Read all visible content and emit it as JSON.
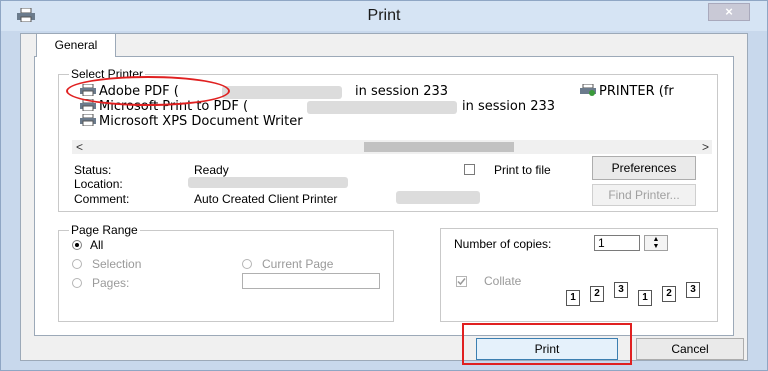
{
  "window": {
    "title": "Print",
    "close_symbol": "×"
  },
  "tabs": [
    {
      "label": "General"
    }
  ],
  "select_printer": {
    "title": "Select Printer",
    "printers": [
      {
        "name": "Adobe PDF (",
        "session": "in session 233"
      },
      {
        "name": "Microsoft Print to PDF (",
        "session": "in session 233"
      },
      {
        "name": "Microsoft XPS Document Writer",
        "session": ""
      },
      {
        "name": "PRINTER (fr",
        "session": ""
      }
    ],
    "scroll_left": "<",
    "scroll_right": ">",
    "status_label": "Status:",
    "status_value": "Ready",
    "location_label": "Location:",
    "location_value": "",
    "comment_label": "Comment:",
    "comment_value": "Auto Created Client Printer",
    "print_to_file_label": "Print to file",
    "print_to_file_checked": false,
    "preferences_label": "Preferences",
    "find_printer_label": "Find Printer..."
  },
  "page_range": {
    "title": "Page Range",
    "all_label": "All",
    "selection_label": "Selection",
    "current_page_label": "Current Page",
    "pages_label": "Pages:",
    "pages_value": "",
    "selected": "All"
  },
  "copies": {
    "number_label": "Number of copies:",
    "number_value": "1",
    "collate_label": "Collate",
    "collate_checked": true,
    "collate_pages": [
      "1",
      "2",
      "3"
    ]
  },
  "footer": {
    "print_label": "Print",
    "cancel_label": "Cancel"
  },
  "colors": {
    "annotation_red": "#e02020",
    "window_frame": "#c8d8ec"
  }
}
